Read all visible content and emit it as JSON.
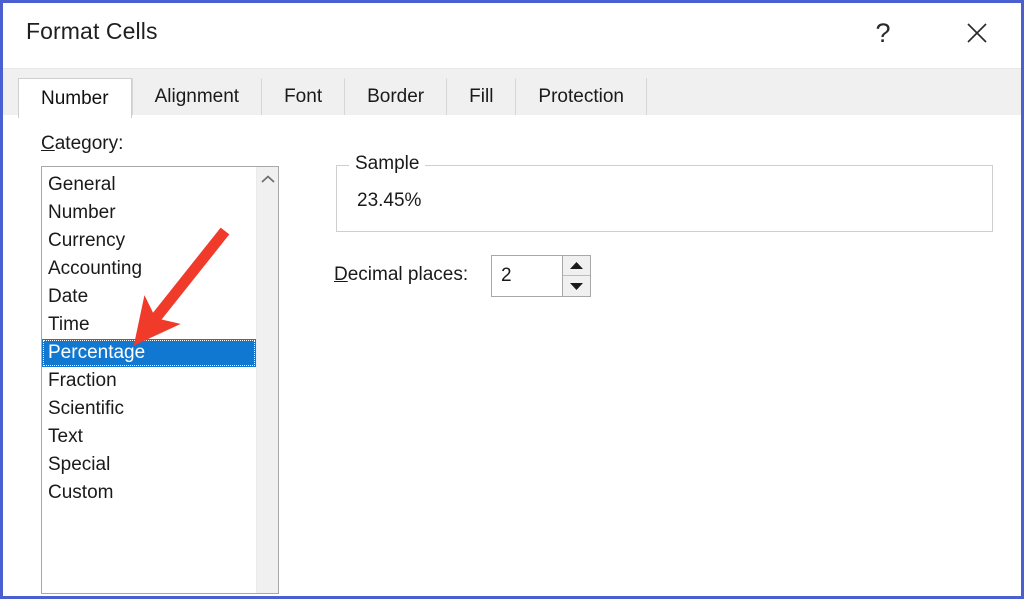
{
  "window": {
    "title": "Format Cells",
    "help_icon": "question-mark-icon",
    "help_glyph": "?",
    "close_icon": "close-icon",
    "close_glyph": "✕"
  },
  "tabs": [
    {
      "label": "Number",
      "active": true
    },
    {
      "label": "Alignment",
      "active": false
    },
    {
      "label": "Font",
      "active": false
    },
    {
      "label": "Border",
      "active": false
    },
    {
      "label": "Fill",
      "active": false
    },
    {
      "label": "Protection",
      "active": false
    }
  ],
  "category": {
    "label_accel": "C",
    "label_rest": "ategory:",
    "items": [
      {
        "label": "General",
        "selected": false
      },
      {
        "label": "Number",
        "selected": false
      },
      {
        "label": "Currency",
        "selected": false
      },
      {
        "label": "Accounting",
        "selected": false
      },
      {
        "label": "Date",
        "selected": false
      },
      {
        "label": "Time",
        "selected": false
      },
      {
        "label": "Percentage",
        "selected": true
      },
      {
        "label": "Fraction",
        "selected": false
      },
      {
        "label": "Scientific",
        "selected": false
      },
      {
        "label": "Text",
        "selected": false
      },
      {
        "label": "Special",
        "selected": false
      },
      {
        "label": "Custom",
        "selected": false
      }
    ],
    "scroll_up_icon": "chevron-up-icon",
    "scroll_up_glyph": "∧"
  },
  "sample": {
    "legend": "Sample",
    "value": "23.45%"
  },
  "decimal_places": {
    "label_accel": "D",
    "label_rest": "ecimal places:",
    "value": "2",
    "spin_up_icon": "triangle-up-icon",
    "spin_up_glyph": "▲",
    "spin_down_icon": "triangle-down-icon",
    "spin_down_glyph": "▼"
  },
  "annotation": {
    "arrow_color": "#F03A2A",
    "arrow_name": "red-pointer-arrow",
    "points_at": "Percentage"
  },
  "colors": {
    "selection_blue": "#1178D2",
    "frame_blue": "#4A5FD0",
    "tabstrip_gray": "#F0F0F0",
    "border_gray": "#A8A8A8"
  }
}
